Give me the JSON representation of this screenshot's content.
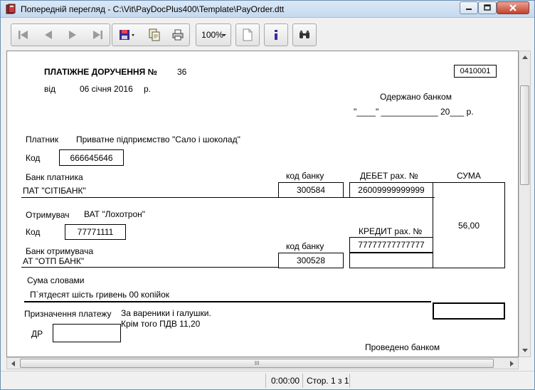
{
  "window": {
    "title": "Попередній перегляд - C:\\Vit\\PayDocPlus400\\Template\\PayOrder.dtt"
  },
  "toolbar": {
    "zoom": "100%",
    "icons": [
      "first-page-icon",
      "prev-page-icon",
      "next-page-icon",
      "last-page-icon",
      "save-icon",
      "copy-icon",
      "print-icon",
      "page-icon",
      "info-icon",
      "find-icon"
    ]
  },
  "doc": {
    "heading": "ПЛАТІЖНЕ ДОРУЧЕННЯ №",
    "number": "36",
    "form_code": "0410001",
    "date_prefix": "від",
    "date": "06 січня 2016",
    "date_suffix": "р.",
    "received_label": "Одержано банком",
    "received_line": "\"____\" ____________ 20___ р.",
    "payer_label": "Платник",
    "payer_name": "Приватне підприємство \"Сало і шоколад\"",
    "payer_code_label": "Код",
    "payer_code": "666645646",
    "payer_bank_label": "Банк платника",
    "bank_code_label": "код банку",
    "debit_label": "ДЕБЕТ рах. №",
    "sum_label": "СУМА",
    "payer_bank": "ПАТ \"СІТІБАНК\"",
    "payer_bank_code": "300584",
    "debit_account": "26009999999999",
    "amount": "56,00",
    "recipient_label": "Отримувач",
    "recipient_name": "ВАТ \"Лохотрон\"",
    "recipient_code_label": "Код",
    "recipient_code": "77771111",
    "credit_label": "КРЕДИТ рах. №",
    "credit_account": "77777777777777",
    "recipient_bank_label": "Банк отримувача",
    "recipient_bank_code_label": "код банку",
    "recipient_bank": "АТ \"ОТП БАНК\"",
    "recipient_bank_code": "300528",
    "sum_words_label": "Сума словами",
    "sum_words": "П`ятдесят шість гривень 00 копійок",
    "purpose_label": "Призначення платежу",
    "purpose_line1": "За вареники і галушки.",
    "purpose_line2": "Крім того ПДВ 11,20",
    "dr_label": "ДР",
    "processed_label": "Проведено банком"
  },
  "status": {
    "time": "0:00:00",
    "page": "Стор. 1 з 1"
  },
  "colors": {
    "titlebar": "#c5d9ee",
    "close_button": "#c3412c",
    "info_icon": "#3b2a9e"
  }
}
